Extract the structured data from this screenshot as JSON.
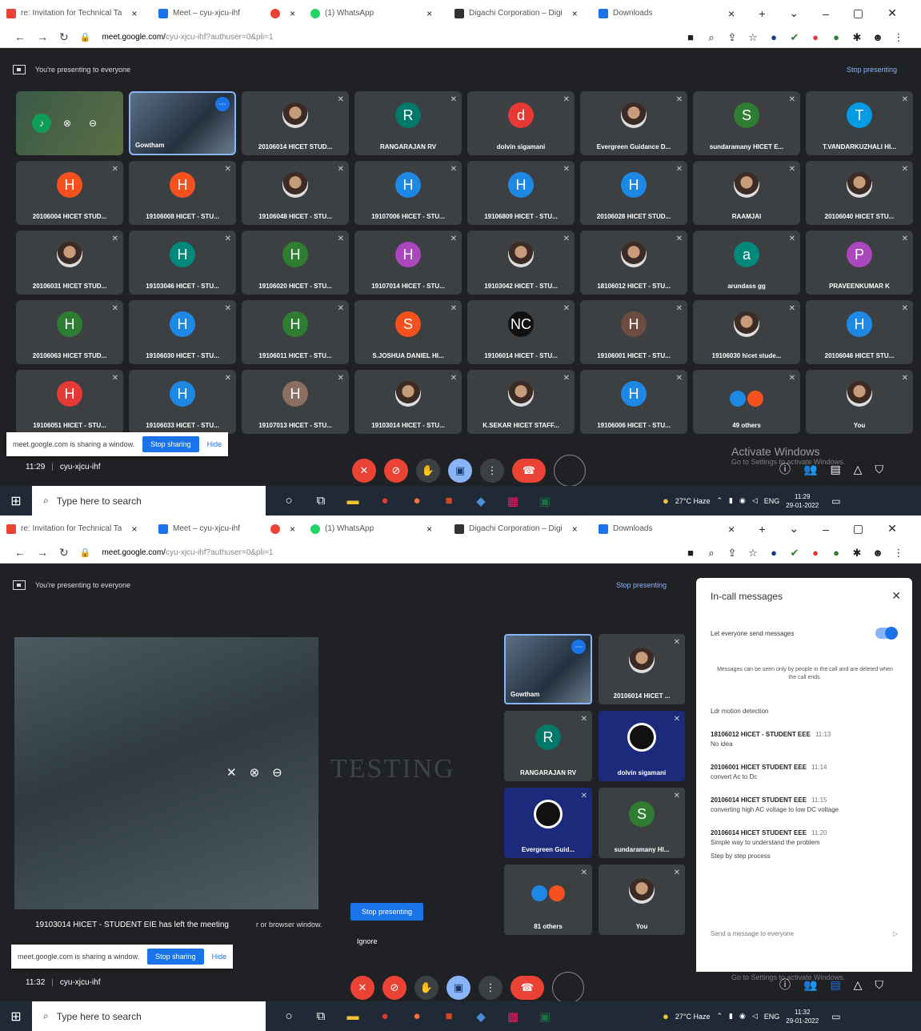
{
  "browser": {
    "tabs": [
      {
        "label": "re: Invitation for Technical Ta",
        "color": "#ea4335"
      },
      {
        "label": "Meet – cyu-xjcu-ihf",
        "color": "#1a73e8"
      },
      {
        "label": "",
        "color": "#ea4335"
      },
      {
        "label": "(1) WhatsApp",
        "color": "#25d366"
      },
      {
        "label": "Digachi Corporation – Digi",
        "color": "#333333"
      },
      {
        "label": "Downloads",
        "color": "#1a73e8"
      }
    ],
    "url_host": "meet.google.com/",
    "url_path": "cyu-xjcu-ihf?authuser=0&pli=1"
  },
  "meet": {
    "presenting_banner": "You're presenting to everyone",
    "stop_presenting": "Stop presenting",
    "share_notice": "meet.google.com is sharing a window.",
    "stop_sharing": "Stop sharing",
    "hide": "Hide",
    "meeting_code": "cyu-xjcu-ihf",
    "activate_windows": "Activate Windows",
    "activate_sub": "Go to Settings to activate Windows."
  },
  "shot1": {
    "time": "11:29",
    "tiles": [
      {
        "name": "",
        "type": "presenting"
      },
      {
        "name": "Gowtham",
        "type": "video"
      },
      {
        "name": "20106014 HICET STUD...",
        "type": "photo"
      },
      {
        "name": "RANGARAJAN RV",
        "letter": "R",
        "color": "#00796b"
      },
      {
        "name": "dolvin sigamani",
        "letter": "d",
        "color": "#e53935"
      },
      {
        "name": "Evergreen Guidance D...",
        "type": "photo"
      },
      {
        "name": "sundaramany HICET E...",
        "letter": "S",
        "color": "#2e7d32"
      },
      {
        "name": "T.VANDARKUZHALI HI...",
        "letter": "T",
        "color": "#039be5"
      },
      {
        "name": "20106004 HICET STUD...",
        "letter": "H",
        "color": "#f4511e"
      },
      {
        "name": "19106008 HICET - STU...",
        "letter": "H",
        "color": "#f4511e"
      },
      {
        "name": "19106048 HICET - STU...",
        "type": "photo"
      },
      {
        "name": "19107006 HICET - STU...",
        "letter": "H",
        "color": "#1e88e5"
      },
      {
        "name": "19106809 HICET - STU...",
        "letter": "H",
        "color": "#1e88e5"
      },
      {
        "name": "20106028 HICET STUD...",
        "letter": "H",
        "color": "#1e88e5"
      },
      {
        "name": "RAAMJAI",
        "type": "photo"
      },
      {
        "name": "20106040 HICET STU...",
        "type": "photo"
      },
      {
        "name": "20106031 HICET STUD...",
        "type": "photo"
      },
      {
        "name": "19103046 HICET - STU...",
        "letter": "H",
        "color": "#00897b"
      },
      {
        "name": "19106020 HICET - STU...",
        "letter": "H",
        "color": "#2e7d32"
      },
      {
        "name": "19107014 HICET - STU...",
        "letter": "H",
        "color": "#ab47bc"
      },
      {
        "name": "19103042 HICET - STU...",
        "type": "photo"
      },
      {
        "name": "18106012 HICET - STU...",
        "type": "photo"
      },
      {
        "name": "arundass gg",
        "letter": "a",
        "color": "#00897b"
      },
      {
        "name": "PRAVEENKUMAR K",
        "letter": "P",
        "color": "#ab47bc"
      },
      {
        "name": "20106063 HICET STUD...",
        "letter": "H",
        "color": "#2e7d32"
      },
      {
        "name": "19106030 HICET - STU...",
        "letter": "H",
        "color": "#1e88e5"
      },
      {
        "name": "19106011 HICET - STU...",
        "letter": "H",
        "color": "#2e7d32"
      },
      {
        "name": "S.JOSHUA DANIEL HI...",
        "letter": "S",
        "color": "#f4511e"
      },
      {
        "name": "19106014 HICET - STU...",
        "letter": "NC",
        "color": "#111111"
      },
      {
        "name": "19106001 HICET - STU...",
        "letter": "H",
        "color": "#6d4c41"
      },
      {
        "name": "19106030 hicet stude...",
        "type": "photo"
      },
      {
        "name": "20106046 HICET STU...",
        "letter": "H",
        "color": "#1e88e5"
      },
      {
        "name": "19106051 HICET - STU...",
        "letter": "H",
        "color": "#e53935"
      },
      {
        "name": "19106033 HICET - STU...",
        "letter": "H",
        "color": "#1e88e5"
      },
      {
        "name": "19107013 HICET - STU...",
        "letter": "H",
        "color": "#8d6e63"
      },
      {
        "name": "19103014 HICET - STU...",
        "type": "photo"
      },
      {
        "name": "K.SEKAR HICET STAFF...",
        "type": "photo"
      },
      {
        "name": "19106006 HICET - STU...",
        "letter": "H",
        "color": "#1e88e5"
      },
      {
        "name": "49 others",
        "type": "others"
      },
      {
        "name": "You",
        "type": "photo"
      }
    ]
  },
  "shot2": {
    "time": "11:32",
    "watermark": "TESTING",
    "left_toast": "19103014 HICET - STUDENT EIE has left the meeting",
    "toast_tail": "r or browser window.",
    "ignore": "Ignore",
    "side_tiles": [
      {
        "name": "Gowtham",
        "type": "video"
      },
      {
        "name": "20106014 HICET ...",
        "type": "photo"
      },
      {
        "name": "RANGARAJAN RV",
        "letter": "R",
        "color": "#00796b"
      },
      {
        "name": "dolvin sigamani",
        "type": "obs"
      },
      {
        "name": "Evergreen Guid...",
        "type": "obs"
      },
      {
        "name": "sundaramany HI...",
        "letter": "S",
        "color": "#2e7d32"
      },
      {
        "name": "81 others",
        "type": "others"
      },
      {
        "name": "You",
        "type": "photo"
      }
    ],
    "chat": {
      "title": "In-call messages",
      "toggle_label": "Let everyone send messages",
      "note": "Messages can be seen only by people in the call and are deleted when the call ends.",
      "messages": [
        {
          "sender": "",
          "time": "",
          "body": "Ldr motion detection",
          "body2": ""
        },
        {
          "sender": "18106012 HICET - STUDENT EEE",
          "time": "11:13",
          "body": "No idea",
          "body2": ""
        },
        {
          "sender": "20106001 HICET STUDENT EEE",
          "time": "11:14",
          "body": "convert Ac to Dc",
          "body2": ""
        },
        {
          "sender": "20106014 HICET STUDENT EEE",
          "time": "11:15",
          "body": "converting high AC voltage to low DC voltage",
          "body2": ""
        },
        {
          "sender": "20106014 HICET STUDENT EEE",
          "time": "11:20",
          "body": "Simple way to understand the problem",
          "body2": "Step by step process"
        }
      ],
      "send_placeholder": "Send a message to everyone"
    }
  },
  "taskbar": {
    "search_placeholder": "Type here to search",
    "weather": "27°C Haze",
    "lang": "ENG",
    "clock1_time": "11:29",
    "clock2_time": "11:32",
    "date": "29-01-2022"
  }
}
